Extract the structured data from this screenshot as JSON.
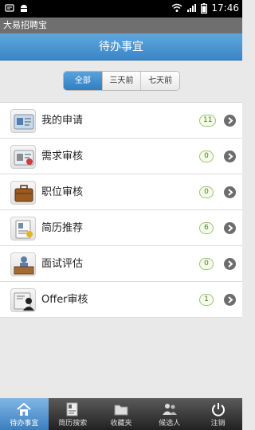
{
  "status_bar": {
    "time": "17:46",
    "icons": [
      "notification-icon",
      "android-icon",
      "wifi-icon",
      "signal-icon",
      "battery-icon"
    ]
  },
  "app": {
    "title": "大易招聘宝"
  },
  "header": {
    "title": "待办事宜"
  },
  "filter": {
    "options": [
      "全部",
      "三天前",
      "七天前"
    ],
    "selected": "全部"
  },
  "list": {
    "items": [
      {
        "label": "我的申请",
        "count": "11",
        "icon": "id-card-icon"
      },
      {
        "label": "需求审核",
        "count": "0",
        "icon": "review-card-icon"
      },
      {
        "label": "职位审核",
        "count": "0",
        "icon": "briefcase-icon"
      },
      {
        "label": "简历推荐",
        "count": "6",
        "icon": "resume-badge-icon"
      },
      {
        "label": "面试评估",
        "count": "0",
        "icon": "interview-desk-icon"
      },
      {
        "label": "Offer审核",
        "count": "1",
        "icon": "offer-user-icon"
      }
    ]
  },
  "tabbar": {
    "tabs": [
      {
        "label": "待办事宜",
        "icon": "home-icon",
        "active": true
      },
      {
        "label": "简历搜索",
        "icon": "resume-search-icon",
        "active": false
      },
      {
        "label": "收藏夹",
        "icon": "folder-icon",
        "active": false
      },
      {
        "label": "候选人",
        "icon": "people-icon",
        "active": false
      },
      {
        "label": "注销",
        "icon": "power-icon",
        "active": false
      }
    ]
  },
  "colors": {
    "header_blue": "#3b86c7",
    "badge_green": "#9ac86f",
    "tab_active": "#3c7fbf"
  }
}
